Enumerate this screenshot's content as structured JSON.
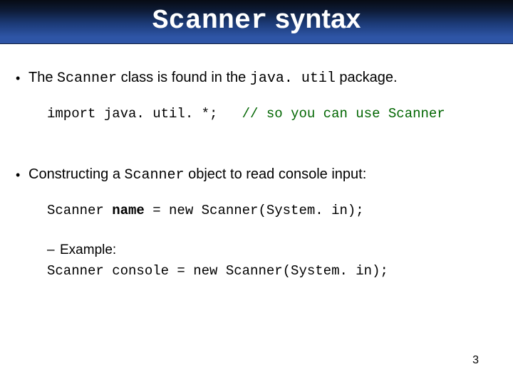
{
  "title": {
    "left": "Scanner",
    "right": " syntax"
  },
  "b1": {
    "pre": "The ",
    "code1": "Scanner",
    "mid": " class is found in the ",
    "code2": "java. util",
    "post": " package."
  },
  "code1": {
    "stmt": "import java. util. *;   ",
    "comment": "// so you can use Scanner"
  },
  "b2": {
    "pre": "Constructing a ",
    "code": "Scanner",
    "post": " object to read console input:"
  },
  "code2": {
    "p1": "Scanner ",
    "name": "name",
    "p2": " = new Scanner(System. in);"
  },
  "sub": {
    "label": "Example:",
    "code": "Scanner console = new Scanner(System. in);"
  },
  "page": "3"
}
